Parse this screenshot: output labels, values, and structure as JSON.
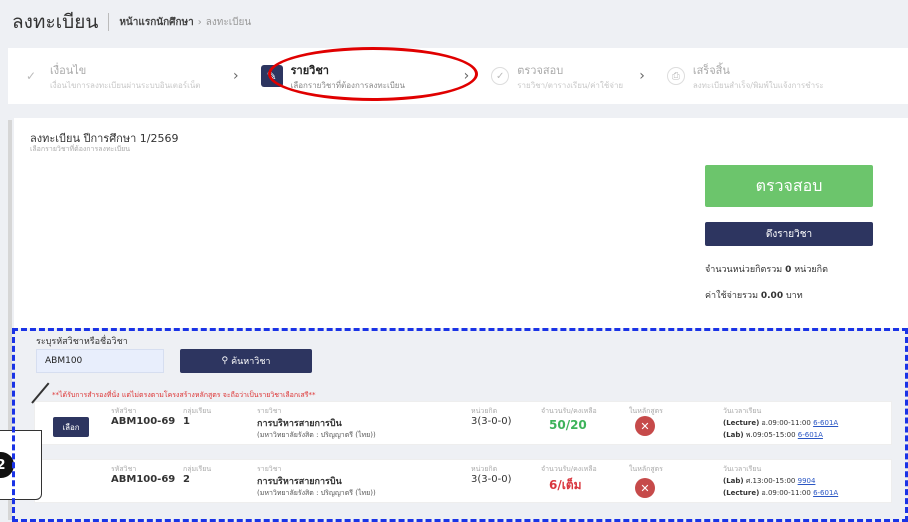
{
  "header": {
    "title": "ลงทะเบียน",
    "breadcrumb": [
      "หน้าแรกนักศึกษา",
      "ลงทะเบียน"
    ]
  },
  "stepper": {
    "steps": [
      {
        "icon": "check-icon",
        "title": "เงื่อนไข",
        "subtitle": "เงื่อนไขการลงทะเบียนผ่านระบบอินเตอร์เน็ต"
      },
      {
        "icon": "pencil-icon",
        "title": "รายวิชา",
        "subtitle": "เลือกรายวิชาที่ต้องการลงทะเบียน"
      },
      {
        "icon": "check-circle-icon",
        "title": "ตรวจสอบ",
        "subtitle": "รายวิชา/ตารางเรียน/ค่าใช้จ่าย"
      },
      {
        "icon": "print-icon",
        "title": "เสร็จสิ้น",
        "subtitle": "ลงทะเบียนสำเร็จ/พิมพ์ใบแจ้งการชำระ"
      }
    ]
  },
  "semester": {
    "title": "ลงทะเบียน ปีการศึกษา 1/2569",
    "subtitle": "เลือกรายวิชาที่ต้องการลงทะเบียน"
  },
  "summary": {
    "check_label": "ตรวจสอบ",
    "pull_label": "ดึงรายวิชา",
    "credits_prefix": "จำนวนหน่วยกิตรวม",
    "credits_value": "0",
    "credits_unit": "หน่วยกิต",
    "cost_prefix": "ค่าใช้จ่ายรวม",
    "cost_value": "0.00",
    "cost_unit": "บาท"
  },
  "search": {
    "label": "ระบุรหัสวิชาหรือชื่อวิชา",
    "value": "ABM100",
    "button": "ค้นหาวิชา"
  },
  "warning": "**ได้รับการสำรองที่นั่ง แต่ไม่ตรงตามโครงสร้างหลักสูตร จะถือว่าเป็นรายวิชาเลือกเสรี**",
  "columns": {
    "code": "รหัสวิชา",
    "group": "กลุ่มเรียน",
    "course": "รายวิชา",
    "credit": "หน่วยกิต",
    "seats": "จำนวนรับ/คงเหลือ",
    "curriculum": "ในหลักสูตร",
    "schedule": "วันเวลาเรียน"
  },
  "courses": [
    {
      "select_label": "เลือก",
      "code": "ABM100-69",
      "group": "1",
      "name": "การบริหารสายการบิน",
      "university": "(มหาวิทยาลัยรังสิต : ปริญญาตรี (ไทย))",
      "credit": "3(3-0-0)",
      "seats": "50/20",
      "sched1_type": "(Lecture)",
      "sched1_time": "อ.09:00-11:00",
      "sched1_room": "6-601A",
      "sched2_type": "(Lab)",
      "sched2_time": "พ.09:05-15:00",
      "sched2_room": "6-601A"
    },
    {
      "code": "ABM100-69",
      "group": "2",
      "name": "การบริหารสายการบิน",
      "university": "(มหาวิทยาลัยรังสิต : ปริญญาตรี (ไทย))",
      "credit": "3(3-0-0)",
      "seats": "6/เต็ม",
      "sched1_type": "(Lab)",
      "sched1_time": "ศ.13:00-15:00",
      "sched1_room": "9904",
      "sched2_type": "(Lecture)",
      "sched2_time": "อ.09:00-11:00",
      "sched2_room": "6-601A"
    }
  ],
  "callout": {
    "number": "2"
  },
  "colors": {
    "primary": "#2d3560",
    "success": "#6cc56c",
    "danger": "#c64a4a",
    "annotation_red": "#e00000",
    "annotation_blue": "#1a33e6"
  }
}
